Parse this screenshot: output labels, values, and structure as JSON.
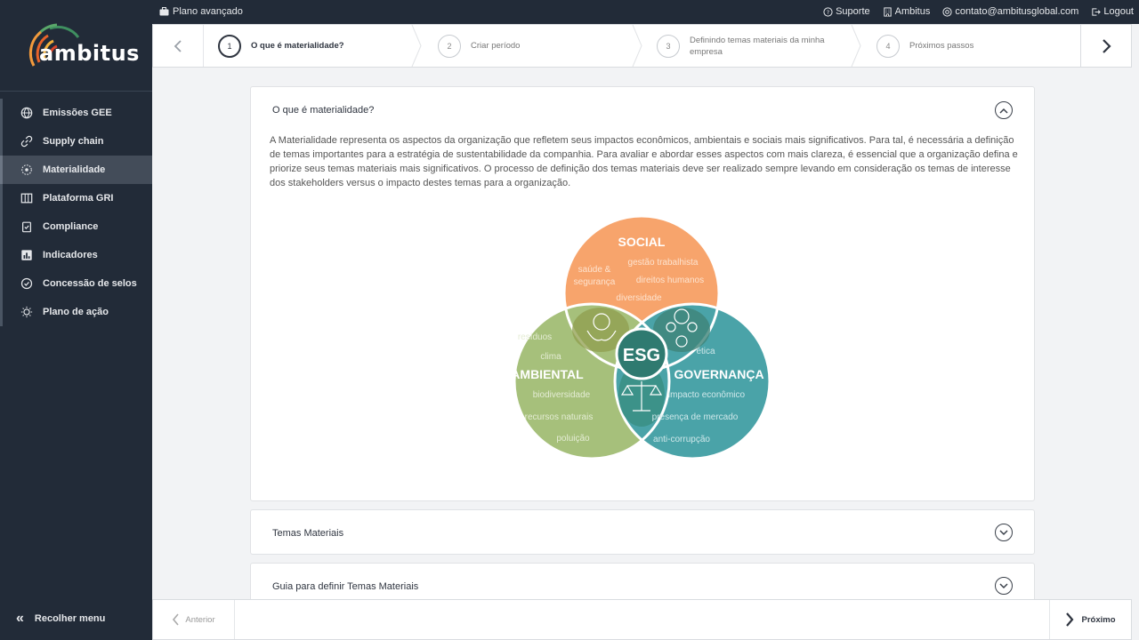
{
  "brand": {
    "name": "ambitus"
  },
  "topbar": {
    "plan": "Plano avançado",
    "support": "Suporte",
    "ambitus": "Ambitus",
    "email": "contato@ambitusglobal.com",
    "logout": "Logout"
  },
  "sidebar": {
    "items": [
      {
        "label": "Emissões GEE",
        "icon": "globe-icon"
      },
      {
        "label": "Supply chain",
        "icon": "link-icon"
      },
      {
        "label": "Materialidade",
        "icon": "target-icon"
      },
      {
        "label": "Plataforma GRI",
        "icon": "columns-icon"
      },
      {
        "label": "Compliance",
        "icon": "clipboard-check-icon"
      },
      {
        "label": "Indicadores",
        "icon": "bar-chart-icon"
      },
      {
        "label": "Concessão de selos",
        "icon": "check-circle-icon"
      },
      {
        "label": "Plano de ação",
        "icon": "lightbulb-icon"
      }
    ],
    "active_index": 2,
    "collapse_label": "Recolher menu"
  },
  "stepper": {
    "steps": [
      {
        "num": "1",
        "label": "O que é materialidade?"
      },
      {
        "num": "2",
        "label": "Criar período"
      },
      {
        "num": "3",
        "label": "Definindo temas materiais da minha empresa"
      },
      {
        "num": "4",
        "label": "Próximos passos"
      }
    ]
  },
  "content": {
    "section1": {
      "title": "O que é materialidade?",
      "description": "A Materialidade representa os aspectos da organização que refletem seus impactos econômicos, ambientais e sociais mais significativos. Para tal, é necessária a definição de temas importantes para a estratégia de sustentabilidade da companhia. Para avaliar e abordar esses aspectos com mais clareza, é essencial que a organização defina e priorize seus temas materiais mais significativos. O processo de definição dos temas materiais deve ser realizado sempre levando em consideração os temas de interesse dos stakeholders versus o impacto destes temas para a organização."
    },
    "section2": {
      "title": "Temas Materiais"
    },
    "section3": {
      "title": "Guia para definir Temas Materiais"
    }
  },
  "venn": {
    "center": "ESG",
    "social": {
      "title": "SOCIAL",
      "color": "#f7a46c",
      "topics": [
        "saúde &",
        "segurança",
        "gestão trabalhista",
        "direitos humanos",
        "diversidade"
      ]
    },
    "ambiental": {
      "title": "AMBIENTAL",
      "color": "#a6c07b",
      "topics": [
        "resíduos",
        "clima",
        "biodiversidade",
        "recursos naturais",
        "poluição"
      ]
    },
    "governanca": {
      "title": "GOVERNANÇA",
      "color": "#4aa3a8",
      "topics": [
        "ética",
        "impacto econômico",
        "presença de mercado",
        "anti-corrupção"
      ]
    }
  },
  "footer": {
    "prev_label": "Anterior",
    "next_label": "Próximo"
  }
}
